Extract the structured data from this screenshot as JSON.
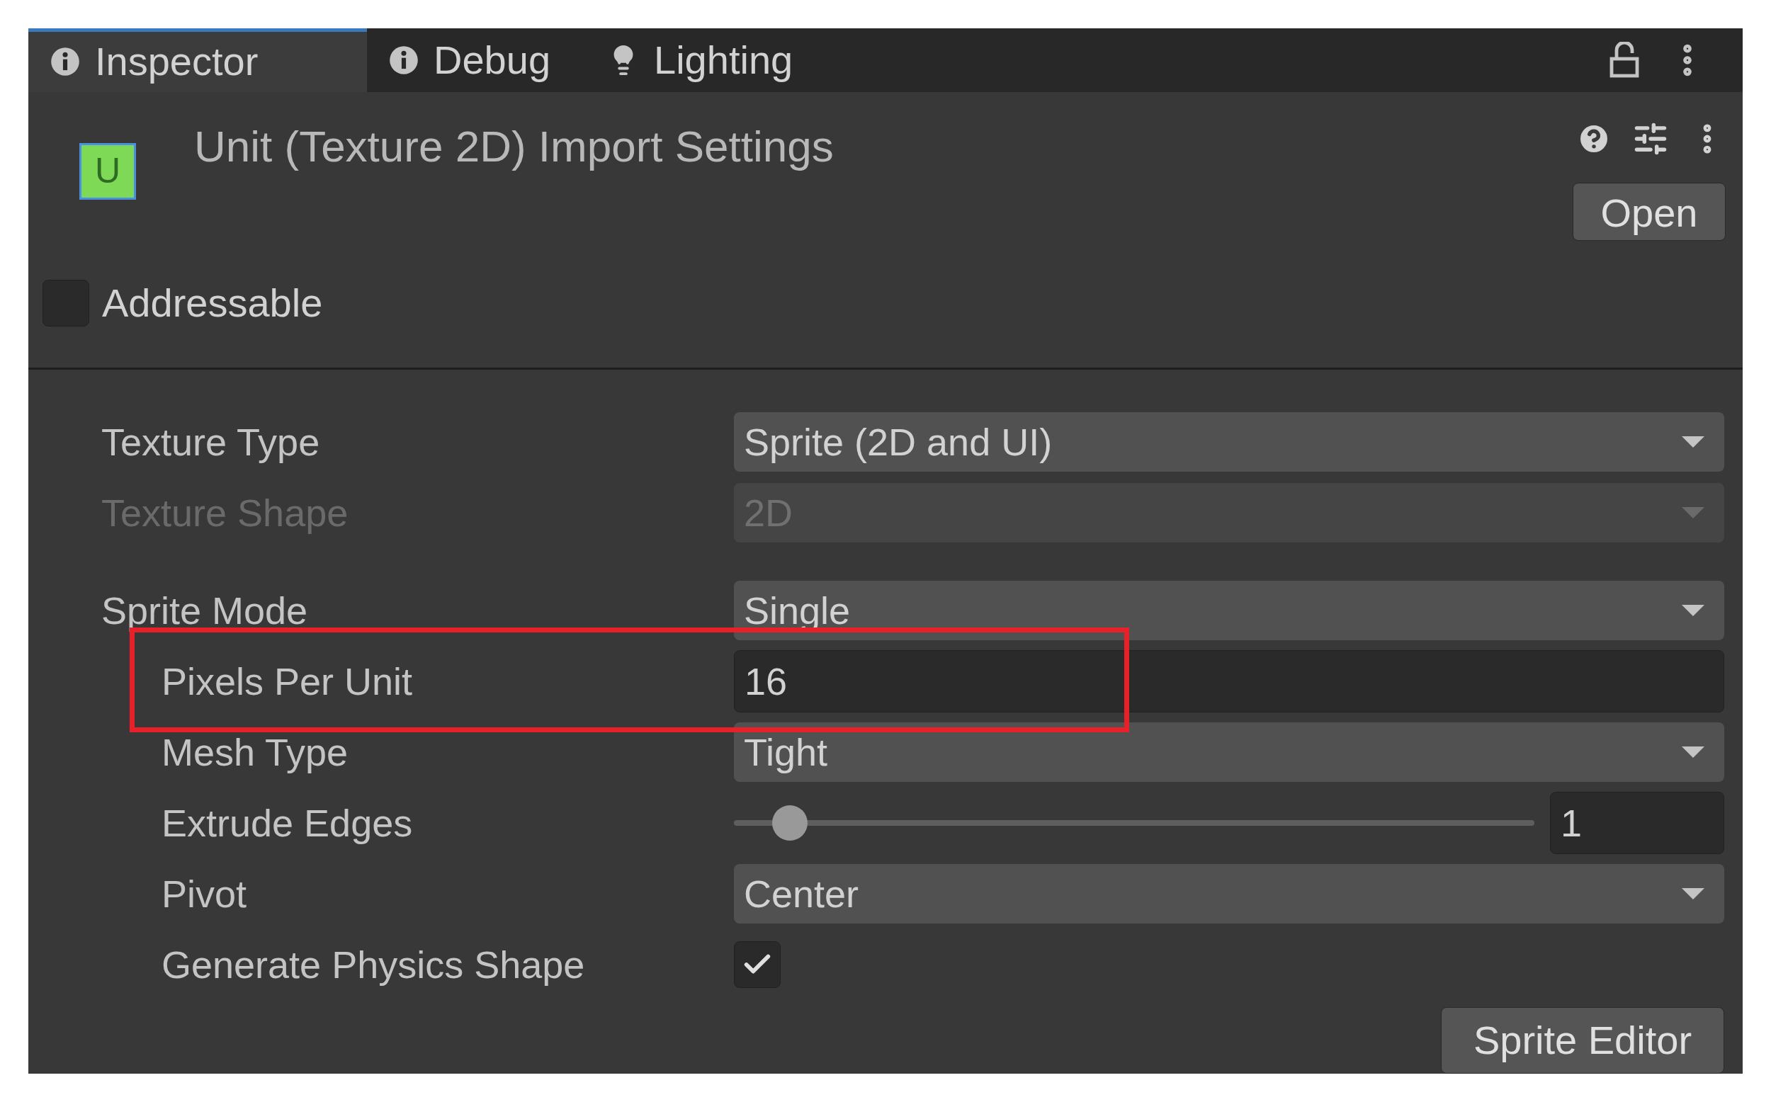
{
  "tabs": [
    {
      "kind": "info",
      "label": "Inspector",
      "selected": true
    },
    {
      "kind": "info",
      "label": "Debug",
      "selected": false
    },
    {
      "kind": "lighting",
      "label": "Lighting",
      "selected": false
    }
  ],
  "header": {
    "badge": "U",
    "title": "Unit (Texture 2D) Import Settings",
    "open_button": "Open"
  },
  "addressable": {
    "label": "Addressable",
    "checked": false
  },
  "groups": [
    [
      {
        "kind": "dropdown",
        "label": "Texture Type",
        "value": "Sprite (2D and UI)",
        "disabled": false
      },
      {
        "kind": "dropdown",
        "label": "Texture Shape",
        "value": "2D",
        "disabled": true
      }
    ],
    [
      {
        "kind": "dropdown",
        "label": "Sprite Mode",
        "value": "Single",
        "disabled": false,
        "children": [
          {
            "kind": "text",
            "label": "Pixels Per Unit",
            "value": "16",
            "highlighted": true
          },
          {
            "kind": "dropdown",
            "label": "Mesh Type",
            "value": "Tight",
            "disabled": false
          },
          {
            "kind": "slider",
            "label": "Extrude Edges",
            "value": "1",
            "level": 0.05
          },
          {
            "kind": "dropdown",
            "label": "Pivot",
            "value": "Center",
            "disabled": false
          },
          {
            "kind": "checkbox",
            "label": "Generate Physics Shape",
            "checked": true
          }
        ]
      }
    ]
  ],
  "sprite_editor_button": "Sprite Editor"
}
